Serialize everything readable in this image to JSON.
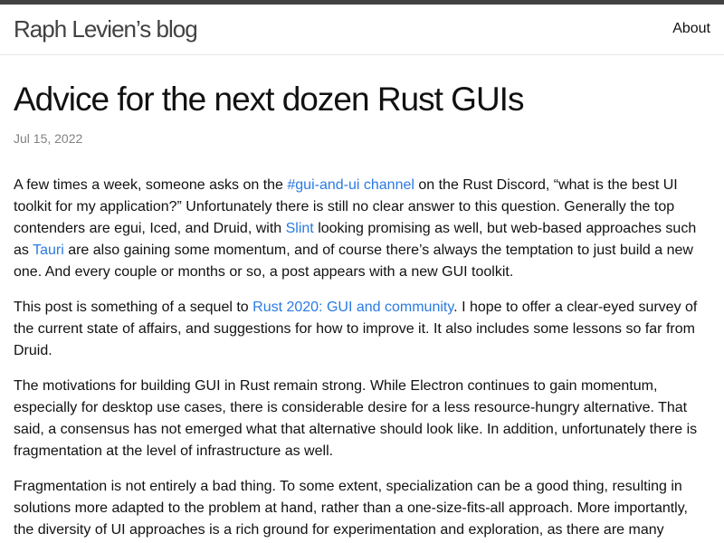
{
  "site": {
    "title": "Raph Levien’s blog",
    "nav": [
      {
        "label": "About"
      }
    ]
  },
  "post": {
    "title": "Advice for the next dozen Rust GUIs",
    "date": "Jul 15, 2022"
  },
  "body": {
    "p1": {
      "t1": "A few times a week, someone asks on the ",
      "link1": "#gui-and-ui channel",
      "t2": " on the Rust Discord, “what is the best UI toolkit for my application?” Unfortunately there is still no clear answer to this question. Generally the top contenders are egui, Iced, and Druid, with ",
      "link2": "Slint",
      "t3": " looking promising as well, but web-based approaches such as ",
      "link3": "Tauri",
      "t4": " are also gaining some momentum, and of course there’s always the temptation to just build a new one. And every couple or months or so, a post appears with a new GUI toolkit."
    },
    "p2": {
      "t1": "This post is something of a sequel to ",
      "link1": "Rust 2020: GUI and community",
      "t2": ". I hope to offer a clear-eyed survey of the current state of affairs, and suggestions for how to improve it. It also includes some lessons so far from Druid."
    },
    "p3": "The motivations for building GUI in Rust remain strong. While Electron continues to gain momentum, especially for desktop use cases, there is considerable desire for a less resource-hungry alternative. That said, a consensus has not emerged what that alternative should look like. In addition, unfortunately there is fragmentation at the level of infrastructure as well.",
    "p4": "Fragmentation is not entirely a bad thing. To some extent, specialization can be a good thing, resulting in solutions more adapted to the problem at hand, rather than a one-size-fits-all approach. More importantly, the diversity of UI approaches is a rich ground for experimentation and exploration, as there are many"
  }
}
